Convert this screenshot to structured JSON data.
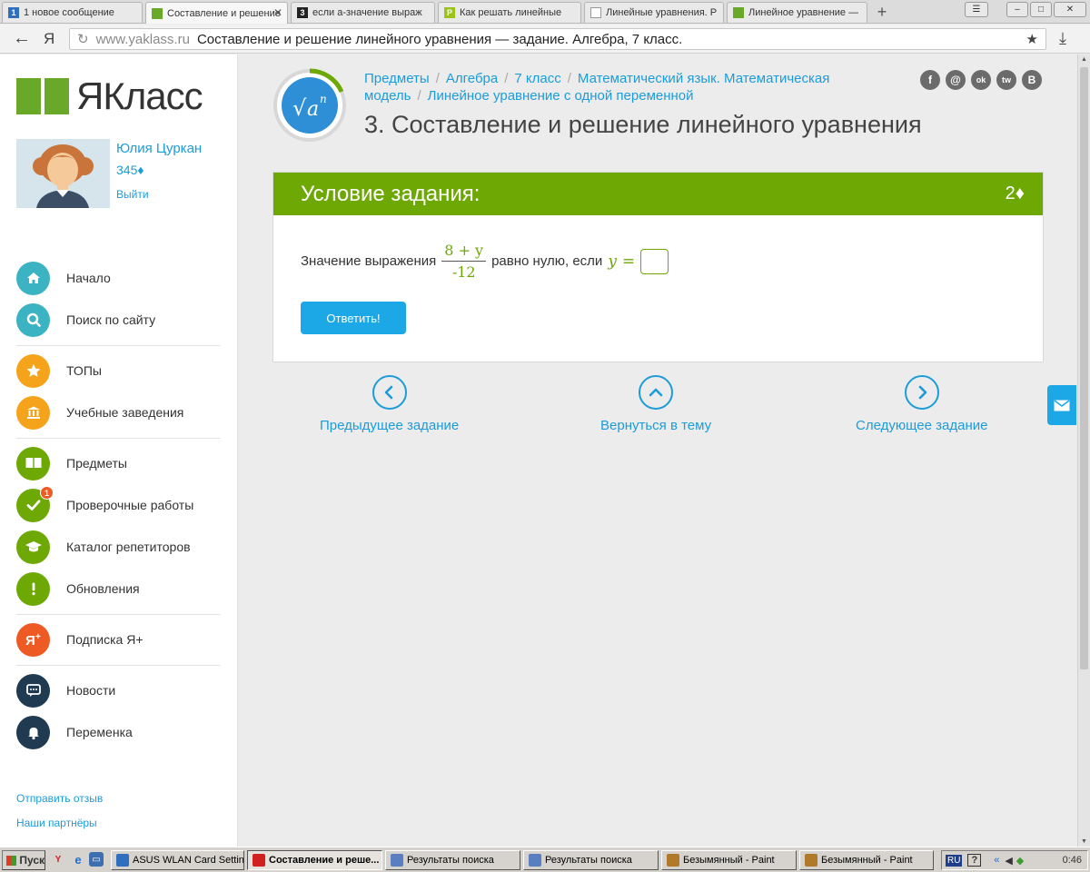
{
  "browser": {
    "tabs": [
      {
        "title": "1 новое сообщение",
        "favicon_text": "1",
        "favicon_color": "#2f6fbd",
        "active": false
      },
      {
        "title": "Составление и решение",
        "favicon_text": "",
        "favicon_color": "#6aa82a",
        "active": true
      },
      {
        "title": "если а-значение выраж",
        "favicon_text": "3",
        "favicon_color": "#222222",
        "active": false
      },
      {
        "title": "Как решать линейные",
        "favicon_text": "P",
        "favicon_color": "#9ac31c",
        "active": false
      },
      {
        "title": "Линейные уравнения. Р",
        "favicon_text": "",
        "favicon_color": "#ffffff",
        "active": false
      },
      {
        "title": "Линейное уравнение —",
        "favicon_text": "",
        "favicon_color": "#6aa82a",
        "active": false
      }
    ],
    "address": {
      "domain": "www.yaklass.ru",
      "page_title": "Составление и решение линейного уравнения — задание. Алгебра, 7 класс."
    }
  },
  "sidebar": {
    "logo_text": "ЯКласс",
    "user": {
      "name": "Юлия Цуркан",
      "points": "345♦",
      "logout": "Выйти"
    },
    "groups": [
      [
        {
          "label": "Начало",
          "icon": "home-icon",
          "color": "#3bb3c3"
        },
        {
          "label": "Поиск по сайту",
          "icon": "search-icon",
          "color": "#3bb3c3"
        }
      ],
      [
        {
          "label": "ТОПы",
          "icon": "star-icon",
          "color": "#f5a31a"
        },
        {
          "label": "Учебные заведения",
          "icon": "building-icon",
          "color": "#f5a31a"
        }
      ],
      [
        {
          "label": "Предметы",
          "icon": "book-icon",
          "color": "#6ea805"
        },
        {
          "label": "Проверочные работы",
          "icon": "check-icon",
          "color": "#6ea805",
          "badge": "1"
        },
        {
          "label": "Каталог репетиторов",
          "icon": "graduation-cap-icon",
          "color": "#6ea805"
        },
        {
          "label": "Обновления",
          "icon": "exclamation-icon",
          "color": "#6ea805"
        }
      ],
      [
        {
          "label": "Подписка Я+",
          "icon": "ya-plus-icon",
          "color": "#ee5a24"
        }
      ],
      [
        {
          "label": "Новости",
          "icon": "chat-icon",
          "color": "#203a52"
        },
        {
          "label": "Переменка",
          "icon": "bell-icon",
          "color": "#203a52"
        }
      ]
    ],
    "footer_links": [
      "Отправить отзыв",
      "Наши партнёры"
    ]
  },
  "breadcrumbs": [
    "Предметы",
    "Алгебра",
    "7 класс",
    "Математический язык. Математическая модель",
    "Линейное уравнение с одной переменной"
  ],
  "page_title": "3. Составление и решение линейного уравнения",
  "social": [
    "f",
    "@",
    "ok",
    "tw",
    "В"
  ],
  "task": {
    "header": "Условие задания:",
    "points": "2♦",
    "question_prefix": "Значение выражения",
    "numerator": "8 + y",
    "denominator": "-12",
    "question_middle": "равно нулю, если",
    "variable": "y",
    "equals": "=",
    "answer_value": "",
    "submit_label": "Ответить!"
  },
  "navigation": {
    "prev": "Предыдущее задание",
    "back": "Вернуться в тему",
    "next": "Следующее задание"
  },
  "taskbar": {
    "start_label": "Пуск",
    "buttons": [
      {
        "label": "ASUS WLAN Card Settings",
        "icon_color": "#2f6fbd",
        "active": false
      },
      {
        "label": "Составление и реше...",
        "icon_color": "#d02020",
        "active": true
      },
      {
        "label": "Результаты поиска",
        "icon_color": "#5a7fc0",
        "active": false
      },
      {
        "label": "Результаты поиска",
        "icon_color": "#5a7fc0",
        "active": false
      },
      {
        "label": "Безымянный - Paint",
        "icon_color": "#b07a2a",
        "active": false
      },
      {
        "label": "Безымянный - Paint",
        "icon_color": "#b07a2a",
        "active": false
      }
    ],
    "tray": {
      "lang": "RU",
      "clock": "0:46"
    }
  }
}
